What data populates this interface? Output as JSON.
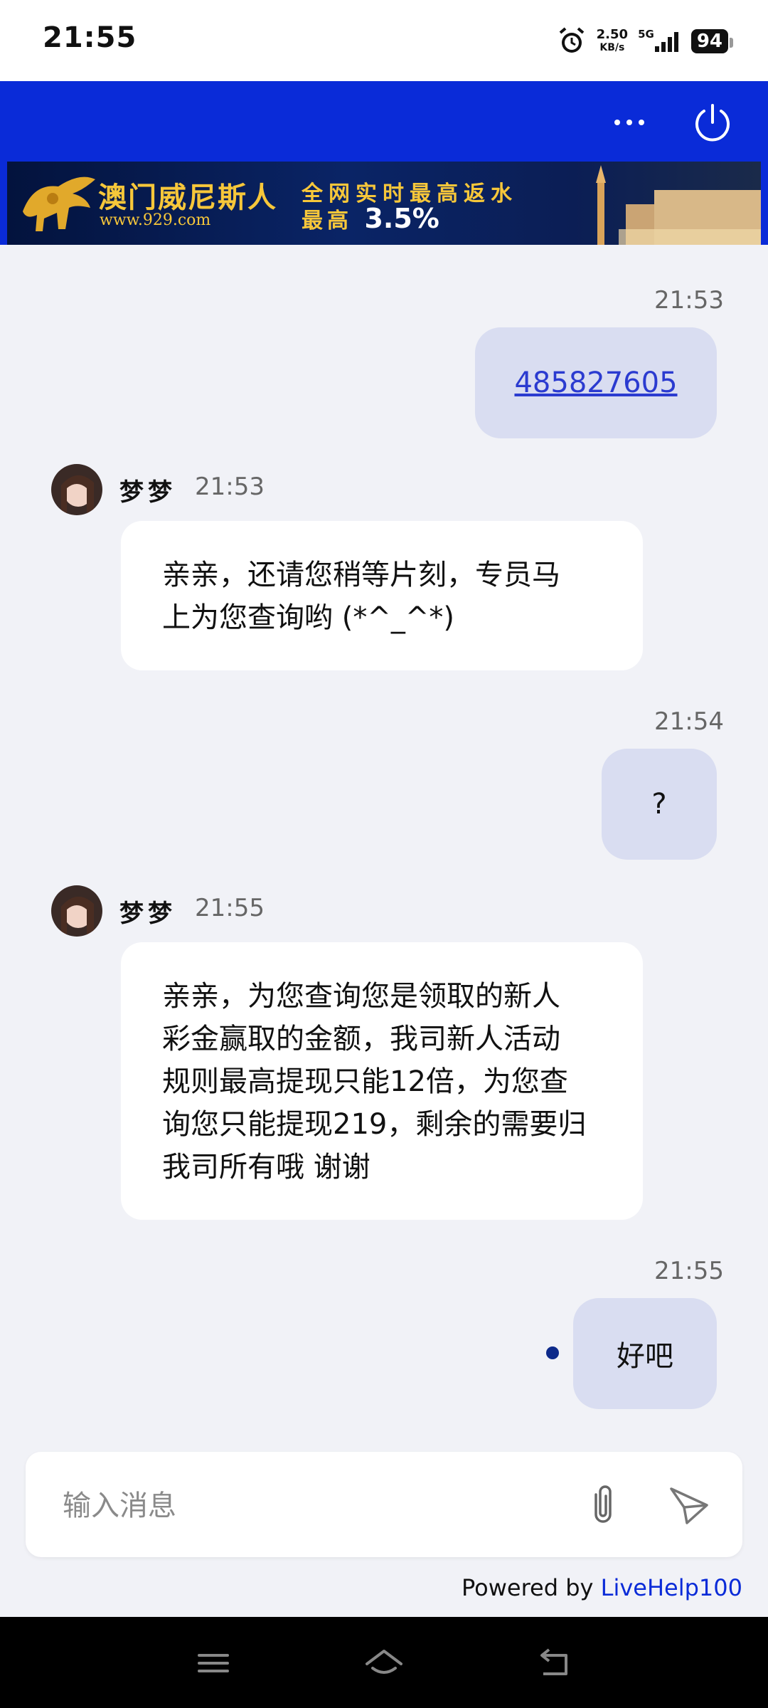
{
  "status_bar": {
    "time": "21:55",
    "net_speed": "2.50",
    "net_unit": "KB/s",
    "network_type": "5G",
    "battery": "94",
    "icons": [
      "alarm-icon",
      "signal-icon",
      "battery-icon"
    ]
  },
  "header": {
    "accent_color": "#0a2bd8",
    "more_icon": "more-horizontal-icon",
    "power_icon": "power-icon"
  },
  "banner": {
    "brand": "澳门威尼斯人",
    "url": "www.929.com",
    "line1": "全网实时最高返水",
    "line2_prefix": "最高",
    "line2_value": "3.5%"
  },
  "messages": [
    {
      "direction": "outgoing",
      "time": "21:53",
      "text": "485827605",
      "is_link": true
    },
    {
      "direction": "incoming",
      "sender": "梦梦",
      "time": "21:53",
      "lines": [
        "亲亲，还请您稍等片刻，专员马",
        "上为您查询哟 (*^_^*)"
      ]
    },
    {
      "direction": "outgoing",
      "time": "21:54",
      "text": "?"
    },
    {
      "direction": "incoming",
      "sender": "梦梦",
      "time": "21:55",
      "lines": [
        "亲亲，为您查询您是领取的新人",
        "彩金赢取的金额，我司新人活动",
        "规则最高提现只能12倍，为您查",
        "询您只能提现219，剩余的需要归",
        "我司所有哦 谢谢"
      ]
    },
    {
      "direction": "outgoing",
      "time": "21:55",
      "text": "好吧",
      "unread": true
    }
  ],
  "composer": {
    "placeholder": "输入消息",
    "attach_icon": "paperclip-icon",
    "send_icon": "send-icon"
  },
  "footer": {
    "powered_prefix": "Powered by",
    "powered_brand": "LiveHelp100"
  },
  "nav_bar": {
    "icons": [
      "menu-icon",
      "home-icon",
      "back-icon"
    ]
  }
}
